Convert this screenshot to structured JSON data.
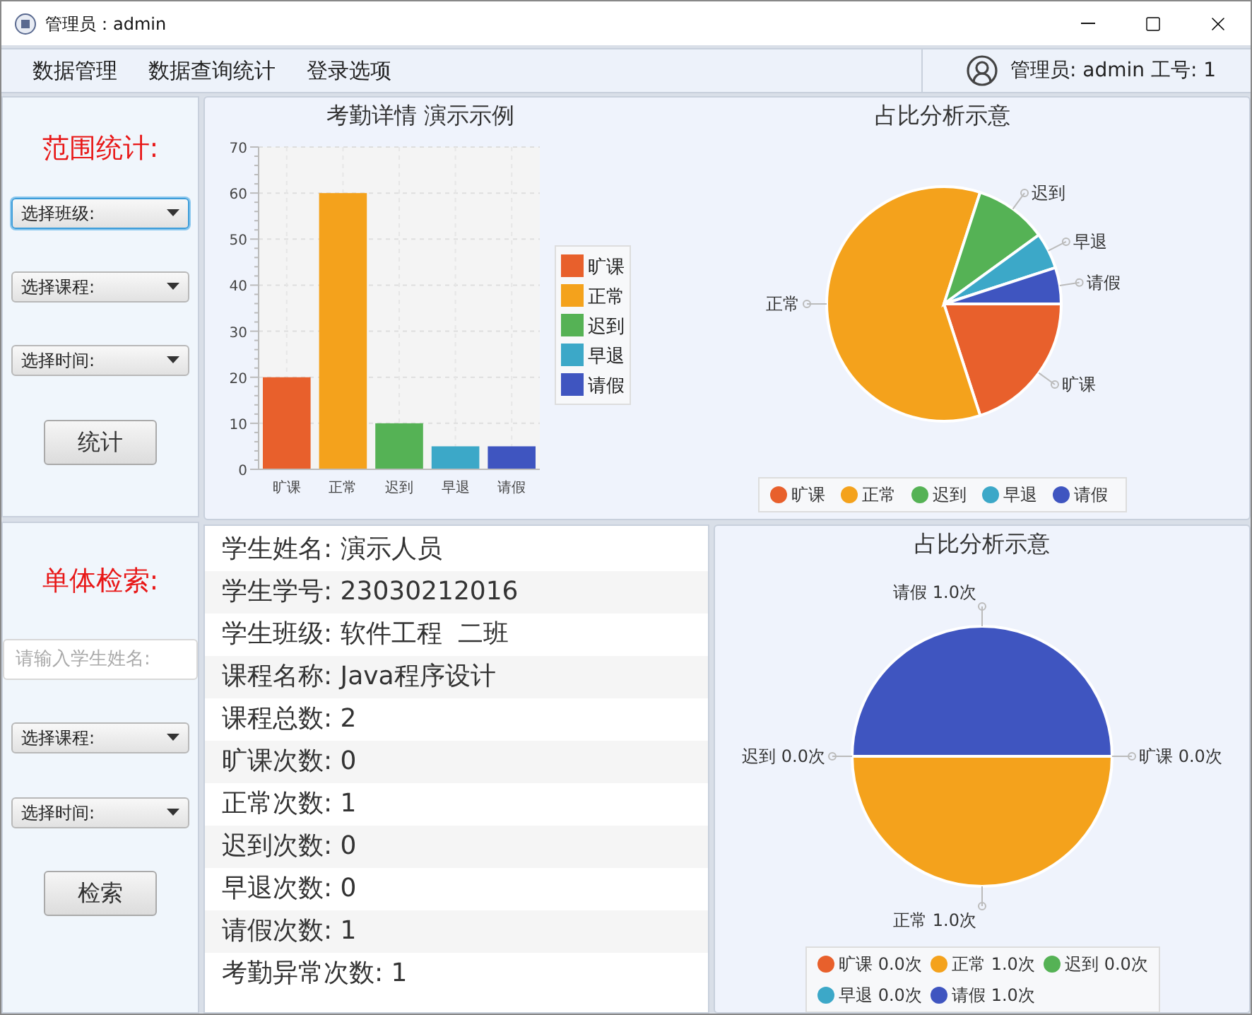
{
  "window": {
    "title": "管理员：admin"
  },
  "menu": [
    "数据管理",
    "数据查询统计",
    "登录选项"
  ],
  "user": {
    "label": "管理员: admin 工号: 1"
  },
  "range_panel": {
    "title": "范围统计:",
    "selects": [
      {
        "label": "选择班级:",
        "focused": true
      },
      {
        "label": "选择课程:",
        "focused": false
      },
      {
        "label": "选择时间:",
        "focused": false
      }
    ],
    "button": "统计"
  },
  "single_panel": {
    "title": "单体检索:",
    "search": {
      "placeholder": "请输入学生姓名:"
    },
    "selects": [
      {
        "label": "选择课程:",
        "focused": false
      },
      {
        "label": "选择时间:",
        "focused": false
      }
    ],
    "button": "检索"
  },
  "bar_chart": {
    "chart_data": {
      "type": "bar",
      "title": "考勤详情 演示示例",
      "categories": [
        "旷课",
        "正常",
        "迟到",
        "早退",
        "请假"
      ],
      "values": [
        20,
        60,
        10,
        5,
        5
      ],
      "ylim": [
        0,
        70
      ],
      "yticks": [
        0,
        10,
        20,
        30,
        40,
        50,
        60,
        70
      ],
      "grid": true
    },
    "legend": [
      {
        "label": "旷课",
        "color": "#e8602c"
      },
      {
        "label": "正常",
        "color": "#f4a21c"
      },
      {
        "label": "迟到",
        "color": "#55b255"
      },
      {
        "label": "早退",
        "color": "#3ca8c8"
      },
      {
        "label": "请假",
        "color": "#3f55c0"
      }
    ]
  },
  "pie_chart": {
    "chart_data": {
      "type": "pie",
      "title": "占比分析示意",
      "categories": [
        "旷课",
        "正常",
        "迟到",
        "早退",
        "请假"
      ],
      "values": [
        20,
        60,
        10,
        5,
        5
      ],
      "legend": "bottom"
    },
    "callouts": [
      "旷课",
      "正常",
      "迟到",
      "早退",
      "请假"
    ],
    "legend": [
      {
        "color": "#e8602c"
      },
      {
        "color": "#f4a21c"
      },
      {
        "color": "#55b255"
      },
      {
        "color": "#3ca8c8"
      },
      {
        "color": "#3f55c0"
      }
    ]
  },
  "student_info": [
    "学生姓名: 演示人员",
    "学生学号: 23030212016",
    "学生班级: 软件工程  二班",
    "课程名称: Java程序设计",
    "课程总数: 2",
    "旷课次数: 0",
    "正常次数: 1",
    "迟到次数: 0",
    "早退次数: 0",
    "请假次数: 1",
    "考勤异常次数: 1"
  ],
  "student_pie": {
    "chart_data": {
      "type": "pie",
      "title": "占比分析示意",
      "categories": [
        "旷课 0.0次",
        "正常 1.0次",
        "迟到 0.0次",
        "早退 0.0次",
        "请假 1.0次"
      ],
      "values": [
        0,
        50,
        0,
        0,
        50
      ],
      "legend": "bottom"
    },
    "callouts": [
      "旷课 0.0次",
      "正常 1.0次",
      "迟到 0.0次",
      "请假 1.0次"
    ],
    "legend": [
      {
        "color": "#e8602c"
      },
      {
        "color": "#f4a21c"
      },
      {
        "color": "#55b255"
      },
      {
        "color": "#3ca8c8"
      },
      {
        "color": "#3f55c0"
      }
    ]
  }
}
